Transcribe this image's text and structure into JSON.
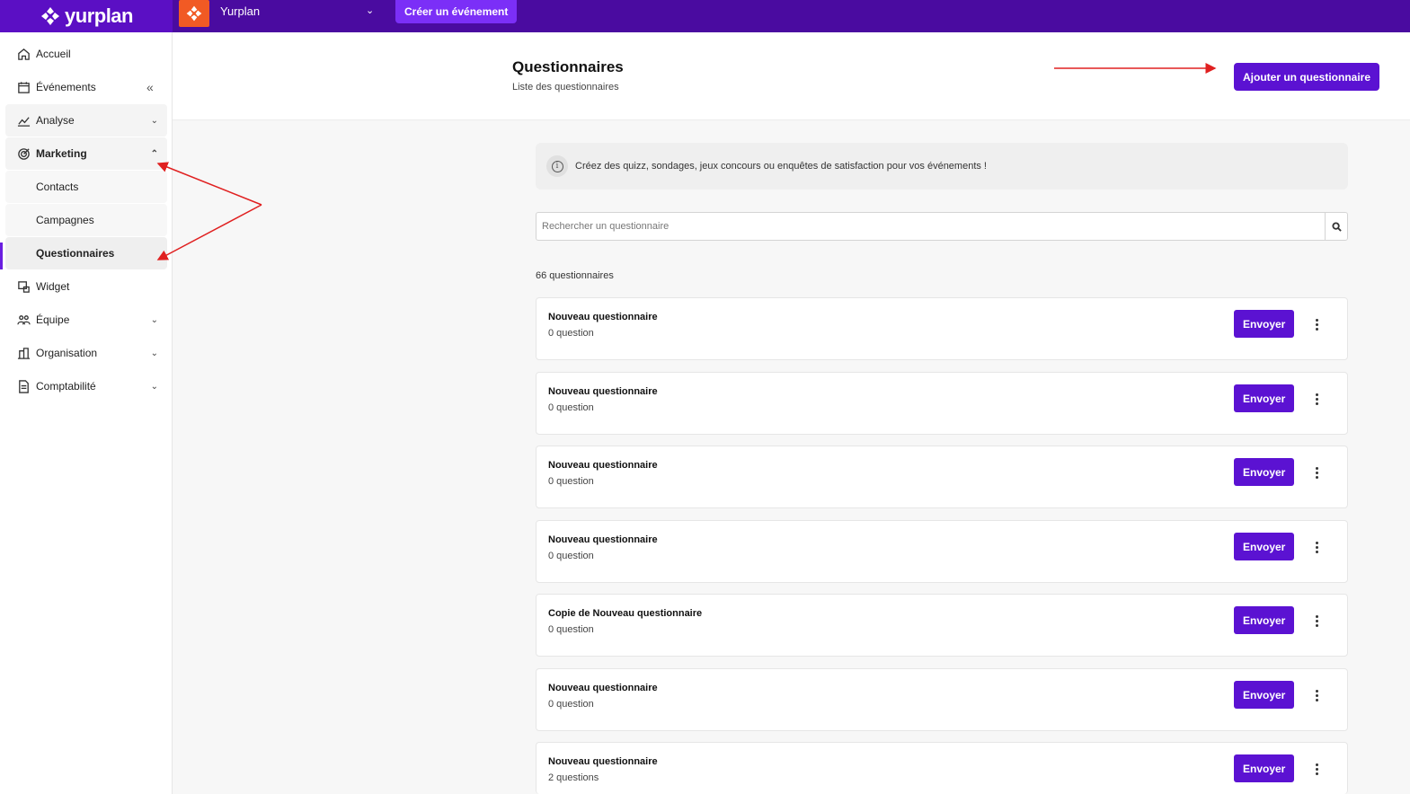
{
  "topbar": {
    "brand": "yurplan",
    "organization": "Yurplan",
    "create_event": "Créer un événement"
  },
  "sidebar": {
    "items": [
      {
        "label": "Accueil",
        "icon": "home-icon"
      },
      {
        "label": "Événements",
        "icon": "calendar-icon"
      },
      {
        "label": "Analyse",
        "icon": "chart-icon"
      },
      {
        "label": "Marketing",
        "icon": "target-icon"
      },
      {
        "label": "Contacts"
      },
      {
        "label": "Campagnes"
      },
      {
        "label": "Questionnaires"
      },
      {
        "label": "Widget",
        "icon": "widget-icon"
      },
      {
        "label": "Équipe",
        "icon": "team-icon"
      },
      {
        "label": "Organisation",
        "icon": "building-icon"
      },
      {
        "label": "Comptabilité",
        "icon": "document-icon"
      }
    ]
  },
  "header": {
    "title": "Questionnaires",
    "subtitle": "Liste des questionnaires",
    "add_button": "Ajouter un questionnaire"
  },
  "info": {
    "text": "Créez des quizz, sondages, jeux concours ou enquêtes de satisfaction pour vos événements !"
  },
  "search": {
    "placeholder": "Rechercher un questionnaire"
  },
  "list": {
    "count": "66 questionnaires",
    "send_label": "Envoyer",
    "items": [
      {
        "name": "Nouveau questionnaire",
        "questions": "0 question"
      },
      {
        "name": "Nouveau questionnaire",
        "questions": "0 question"
      },
      {
        "name": "Nouveau questionnaire",
        "questions": "0 question"
      },
      {
        "name": "Nouveau questionnaire",
        "questions": "0 question"
      },
      {
        "name": "Copie de Nouveau questionnaire",
        "questions": "0 question"
      },
      {
        "name": "Nouveau questionnaire",
        "questions": "0 question"
      },
      {
        "name": "Nouveau questionnaire",
        "questions": "2 questions"
      }
    ]
  },
  "colors": {
    "topbar": "#4a0ba0",
    "primary": "#5b12d2",
    "annotation": "#e02020"
  }
}
